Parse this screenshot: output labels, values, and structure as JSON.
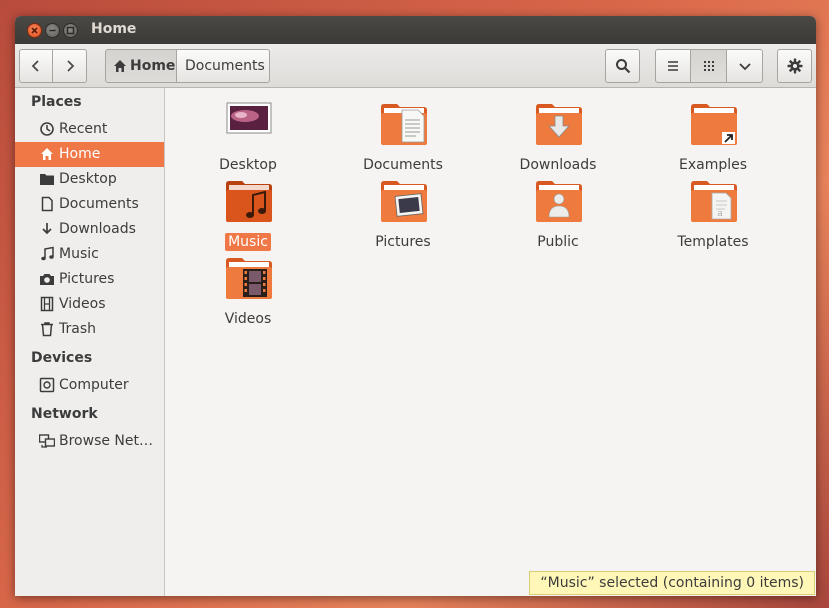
{
  "window": {
    "title": "Home"
  },
  "toolbar": {
    "breadcrumbs": [
      "Home",
      "Documents"
    ],
    "icons": {
      "back": "chevron-left-icon",
      "forward": "chevron-right-icon",
      "search": "search-icon",
      "list": "list-view-icon",
      "grid": "grid-view-icon",
      "options": "chevron-down-icon",
      "settings": "gear-icon"
    }
  },
  "sidebar": {
    "places_header": "Places",
    "places": [
      {
        "label": "Recent",
        "icon": "clock-icon"
      },
      {
        "label": "Home",
        "icon": "home-icon",
        "selected": true
      },
      {
        "label": "Desktop",
        "icon": "desktop-folder-icon"
      },
      {
        "label": "Documents",
        "icon": "document-icon"
      },
      {
        "label": "Downloads",
        "icon": "download-icon"
      },
      {
        "label": "Music",
        "icon": "music-note-icon"
      },
      {
        "label": "Pictures",
        "icon": "camera-icon"
      },
      {
        "label": "Videos",
        "icon": "film-icon"
      },
      {
        "label": "Trash",
        "icon": "trash-icon"
      }
    ],
    "devices_header": "Devices",
    "devices": [
      {
        "label": "Computer",
        "icon": "computer-icon"
      }
    ],
    "network_header": "Network",
    "network": [
      {
        "label": "Browse Net…",
        "icon": "network-icon"
      }
    ]
  },
  "content": {
    "items": [
      {
        "label": "Desktop",
        "kind": "desktop"
      },
      {
        "label": "Documents",
        "kind": "documents"
      },
      {
        "label": "Downloads",
        "kind": "downloads"
      },
      {
        "label": "Examples",
        "kind": "examples"
      },
      {
        "label": "Music",
        "kind": "music",
        "selected": true
      },
      {
        "label": "Pictures",
        "kind": "pictures"
      },
      {
        "label": "Public",
        "kind": "public"
      },
      {
        "label": "Templates",
        "kind": "templates"
      },
      {
        "label": "Videos",
        "kind": "videos"
      }
    ]
  },
  "status": {
    "text": "“Music” selected (containing 0 items)"
  },
  "colors": {
    "accent": "#f07746",
    "folder": "#e8662f",
    "titlebar": "#3c3b37"
  }
}
